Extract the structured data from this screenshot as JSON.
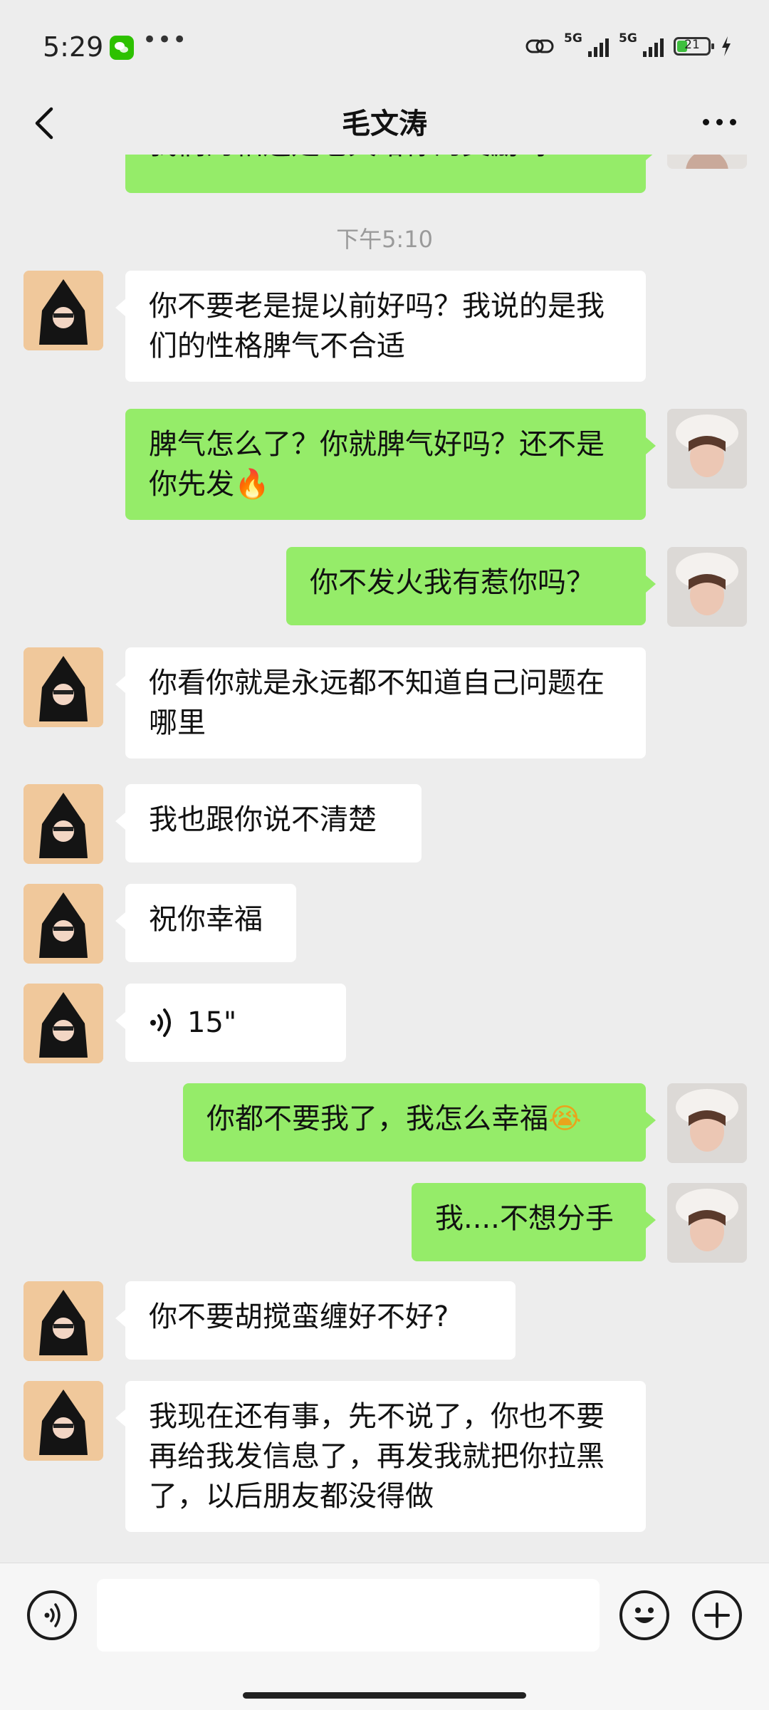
{
  "status": {
    "time": "5:29",
    "battery": "21",
    "sig1": "5G",
    "sig2": "5G"
  },
  "header": {
    "title": "毛文涛"
  },
  "chat": {
    "top_partial": "我们的相遇是老天给你的奖励吗？",
    "time_separator": "下午5:10",
    "messages": [
      {
        "dir": "in",
        "text": "你不要老是提以前好吗？我说的是我们的性格脾气不合适"
      },
      {
        "dir": "out",
        "text": "脾气怎么了？你就脾气好吗？还不是你先发",
        "emoji": "🔥"
      },
      {
        "dir": "out",
        "text": "你不发火我有惹你吗？"
      },
      {
        "dir": "in",
        "text": "你看你就是永远都不知道自己问题在哪里"
      },
      {
        "dir": "in",
        "text": "我也跟你说不清楚"
      },
      {
        "dir": "in",
        "text": "祝你幸福"
      },
      {
        "dir": "in",
        "voice": "15\""
      },
      {
        "dir": "out",
        "text": "你都不要我了，我怎么幸福",
        "emoji": "😭"
      },
      {
        "dir": "out",
        "text": "我....不想分手"
      },
      {
        "dir": "in",
        "text": "你不要胡搅蛮缠好不好?"
      },
      {
        "dir": "in",
        "text": "我现在还有事，先不说了，你也不要再给我发信息了，再发我就把你拉黑了，以后朋友都没得做"
      }
    ]
  },
  "icons": {
    "back": "chevron-left-icon",
    "more": "more-dots-icon",
    "voice": "voice-input-icon",
    "emoji": "emoji-icon",
    "plus": "plus-icon"
  },
  "colors": {
    "incoming": "#ffffff",
    "outgoing": "#95ec69",
    "background": "#ededed"
  }
}
